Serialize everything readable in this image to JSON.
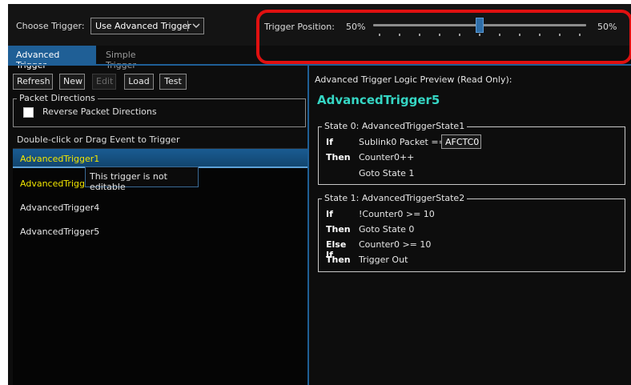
{
  "header": {
    "choose_trigger_label": "Choose Trigger:",
    "choose_trigger_value": "Use Advanced Trigger",
    "trigger_position_label": "Trigger Position:",
    "trigger_position_left": "50%",
    "trigger_position_right": "50%",
    "trigger_position_value": 0.5
  },
  "tabs": [
    {
      "label": "Advanced Trigger",
      "active": true
    },
    {
      "label": "Simple Trigger",
      "active": false
    }
  ],
  "toolbar": {
    "refresh": "Refresh",
    "new": "New",
    "edit": "Edit",
    "load": "Load",
    "test": "Test"
  },
  "packet_directions": {
    "legend": "Packet Directions",
    "reverse_label": "Reverse Packet Directions",
    "reverse_checked": false
  },
  "hint": "Double-click or Drag Event to Trigger",
  "trigger_list": [
    {
      "label": "AdvancedTrigger1",
      "selected": true
    },
    {
      "label": "AdvancedTrigger2",
      "selected": false
    },
    {
      "label": "AdvancedTrigger4",
      "selected": false
    },
    {
      "label": "AdvancedTrigger5",
      "selected": false
    }
  ],
  "tooltip": "This trigger is not editable",
  "preview": {
    "title": "Advanced Trigger Logic Preview (Read Only):",
    "trigger_name": "AdvancedTrigger5",
    "states": [
      {
        "legend": "State 0:  AdvancedTriggerState1",
        "rows": [
          {
            "keyword": "If",
            "text": "Sublink0 Packet ==",
            "value": "AFCTC0"
          },
          {
            "keyword": "Then",
            "text": "Counter0++"
          },
          {
            "keyword": "",
            "text": "Goto State 1"
          }
        ]
      },
      {
        "legend": "State 1:  AdvancedTriggerState2",
        "rows": [
          {
            "keyword": "If",
            "text": "!Counter0 >= 10"
          },
          {
            "keyword": "Then",
            "text": "Goto State 0"
          },
          {
            "keyword": "Else If",
            "text": "Counter0 >= 10"
          },
          {
            "keyword": "Then",
            "text": "Trigger Out"
          }
        ]
      }
    ]
  },
  "colors": {
    "accent": "#1f5f96",
    "highlight_text": "#f2e600",
    "trigger_name": "#35d6c4",
    "annotation": "#e01010"
  }
}
